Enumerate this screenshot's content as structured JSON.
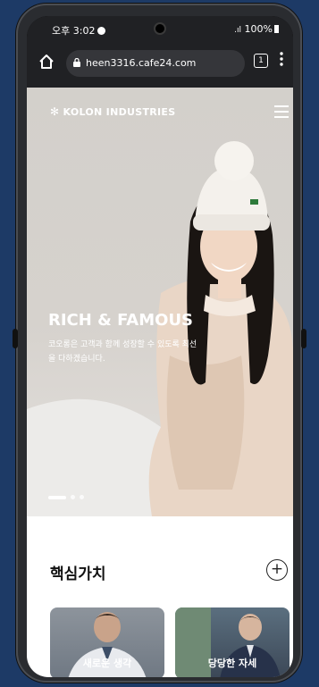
{
  "status_bar": {
    "time": "오후 3:02",
    "battery": "100%"
  },
  "browser": {
    "url": "heen3316.cafe24.com",
    "tab_count": "1"
  },
  "site": {
    "logo": "KOLON INDUSTRIES"
  },
  "hero": {
    "title": "RICH & FAMOUS",
    "subtitle": "코오롱은 고객과 함께 성장할 수 있도록 최선을 다하겠습니다.",
    "slide_count": 3,
    "active_slide": 1
  },
  "section": {
    "title": "핵심가치",
    "cards": [
      {
        "label": "새로운 생각"
      },
      {
        "label": "당당한 자세"
      }
    ]
  },
  "colors": {
    "background": "#1d3a66",
    "browser_bar": "#202124"
  }
}
